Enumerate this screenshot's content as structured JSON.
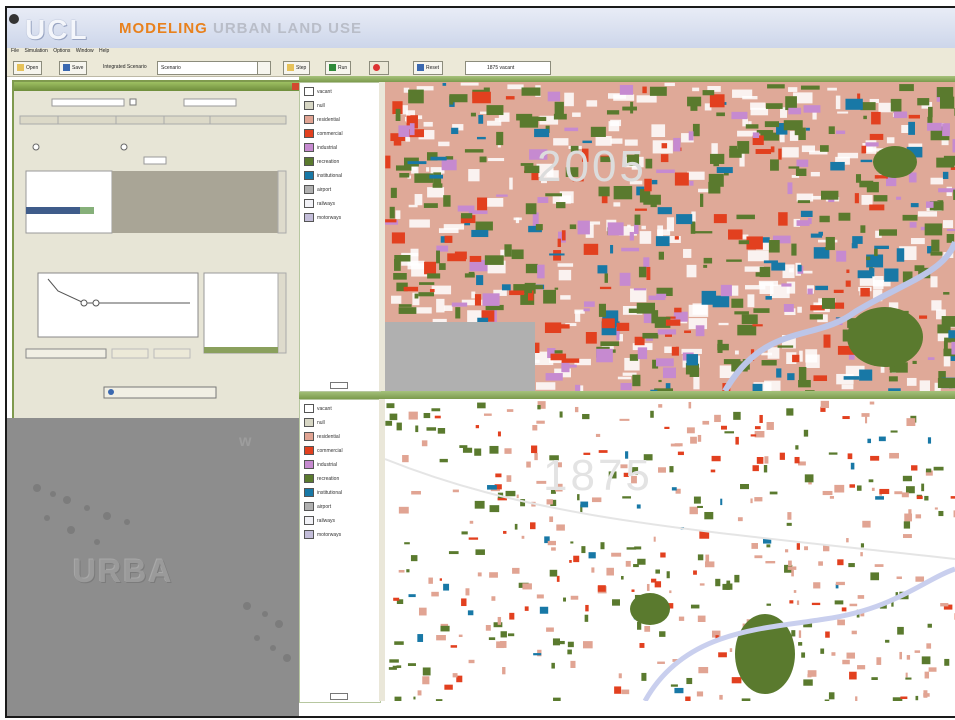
{
  "header": {
    "logo": "UCL",
    "title_part1": "MODELING",
    "title_part2": " URBAN LAND USE"
  },
  "menubar": {
    "items": [
      "File",
      "Simulation",
      "Options",
      "Window",
      "Help"
    ]
  },
  "toolbar": {
    "open": "Open",
    "save": "Save",
    "integration_label": "Integrated Scenario",
    "integration_value": "Scenario",
    "step": "Step",
    "run": "Run",
    "reset": "Reset",
    "time": "1875 vacant"
  },
  "year_top": "2005",
  "year_bottom": "1875",
  "gray_watermark": "URBA",
  "legend": [
    {
      "label": "vacant",
      "color": "#ffffff"
    },
    {
      "label": "null",
      "color": "#d7d6c4"
    },
    {
      "label": "residential",
      "color": "#e1a493"
    },
    {
      "label": "commercial",
      "color": "#e2401f"
    },
    {
      "label": "industrial",
      "color": "#c68ad0"
    },
    {
      "label": "recreation",
      "color": "#5a7a2e"
    },
    {
      "label": "institutional",
      "color": "#1878a6"
    },
    {
      "label": "airport",
      "color": "#b0b0b0"
    },
    {
      "label": "railways",
      "color": "#f1f1f6"
    },
    {
      "label": "motorways",
      "color": "#c3bdd9"
    }
  ],
  "colors": {
    "dialog_header": "#7f9a4e",
    "accent": "#e8811d"
  }
}
